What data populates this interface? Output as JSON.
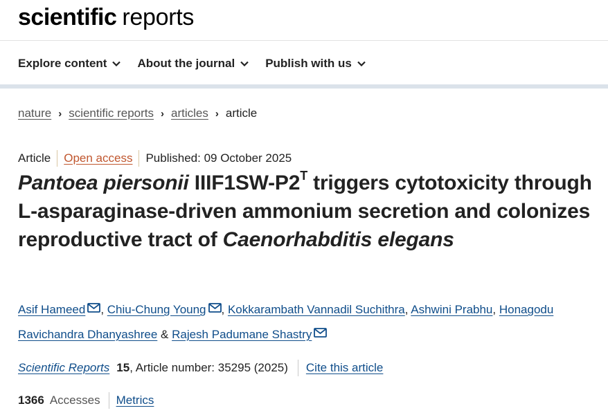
{
  "logo": {
    "bold": "scientific",
    "regular": "reports"
  },
  "nav": {
    "items": [
      {
        "label": "Explore content"
      },
      {
        "label": "About the journal"
      },
      {
        "label": "Publish with us"
      }
    ]
  },
  "breadcrumb": {
    "items": [
      "nature",
      "scientific reports",
      "articles"
    ],
    "current": "article"
  },
  "article": {
    "type": "Article",
    "open_access": "Open access",
    "published": "Published: 09 October 2025",
    "title": {
      "species_italic": "Pantoea piersonii",
      "strain": " IIIF1SW-P2",
      "superscript": "T",
      "middle": " triggers cytotoxicity through L-asparaginase-driven ammonium secretion and colonizes reproductive tract of ",
      "host_italic": "Caenorhabditis elegans"
    },
    "authors": [
      {
        "name": "Asif Hameed",
        "mail": true,
        "after": ", "
      },
      {
        "name": "Chiu-Chung Young",
        "mail": true,
        "after": ", "
      },
      {
        "name": "Kokkarambath Vannadil Suchithra",
        "mail": false,
        "after": ", "
      },
      {
        "name": "Ashwini Prabhu",
        "mail": false,
        "after": ", "
      },
      {
        "name": "Honagodu Ravichandra Dhanyashree",
        "mail": false,
        "after": " & "
      },
      {
        "name": "Rajesh Padumane Shastry",
        "mail": true,
        "after": ""
      }
    ],
    "citation": {
      "journal": "Scientific Reports",
      "volume": "15",
      "article_number": ", Article number: 35295 (2025)",
      "cite_link": "Cite this article"
    },
    "metrics": {
      "accesses_count": "1366",
      "accesses_label": "Accesses",
      "metrics_link": "Metrics"
    }
  },
  "colors": {
    "link_blue": "#0f4d8a",
    "open_access_orange": "#c0562e",
    "header_bar": "#dbe2ea"
  }
}
